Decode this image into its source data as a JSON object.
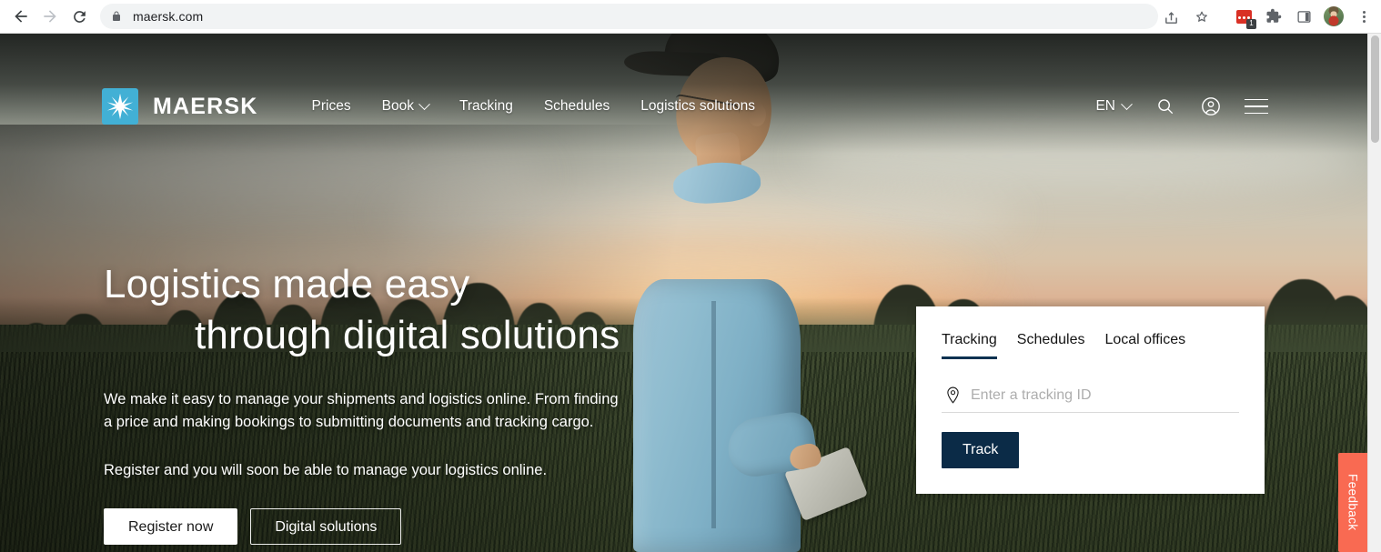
{
  "browser": {
    "url": "maersk.com",
    "back_label": "Back",
    "forward_label": "Forward",
    "reload_label": "Reload",
    "lock_icon": "lock-icon",
    "share_label": "Share",
    "bookmark_label": "Bookmark this tab",
    "extension_badge": "1",
    "extensions_label": "Extensions",
    "side_panel_label": "Side panel",
    "profile_label": "Profile",
    "menu_label": "Customise and control Google Chrome"
  },
  "site": {
    "logo_text": "MAERSK",
    "logo_icon": "maersk-star-icon",
    "logo_bg": "#42b0d5",
    "nav_links": [
      {
        "label": "Prices",
        "has_chevron": false
      },
      {
        "label": "Book",
        "has_chevron": true
      },
      {
        "label": "Tracking",
        "has_chevron": false
      },
      {
        "label": "Schedules",
        "has_chevron": false
      },
      {
        "label": "Logistics solutions",
        "has_chevron": false
      }
    ],
    "language": "EN",
    "search_icon": "search-icon",
    "account_icon": "account-icon",
    "menu_icon": "hamburger-menu-icon"
  },
  "hero": {
    "title_line1": "Logistics made easy",
    "title_line2": "through digital solutions",
    "paragraph1": "We make it easy to manage your shipments and logistics online. From finding a price and making bookings to submitting documents and tracking cargo.",
    "paragraph2": "Register and you will soon be able to manage your logistics online.",
    "primary_button": "Register now",
    "secondary_button": "Digital solutions"
  },
  "track_card": {
    "tabs": [
      {
        "label": "Tracking",
        "active": true
      },
      {
        "label": "Schedules",
        "active": false
      },
      {
        "label": "Local offices",
        "active": false
      }
    ],
    "input_icon": "map-pin-icon",
    "input_placeholder": "Enter a tracking ID",
    "input_value": "",
    "submit_label": "Track",
    "submit_color": "#0b2b47",
    "active_tab_underline_color": "#0c3251"
  },
  "feedback": {
    "label": "Feedback",
    "color": "#f96a52"
  }
}
